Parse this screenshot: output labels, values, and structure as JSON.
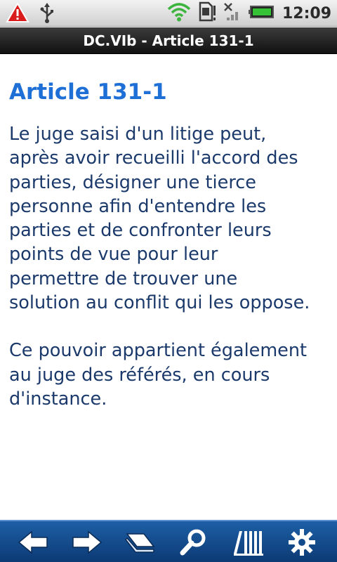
{
  "status_bar": {
    "time": "12:09",
    "icons": [
      "warning-icon",
      "usb-icon",
      "wifi-icon",
      "sd-card-icon",
      "no-signal-icon",
      "battery-icon"
    ]
  },
  "title_bar": {
    "title": "DC.VIb - Article 131-1"
  },
  "article": {
    "heading": "Article 131-1",
    "paragraphs": [
      "Le juge saisi d'un litige peut,\naprès avoir recueilli l'accord des\nparties, désigner une tierce\npersonne afin d'entendre les\nparties et de confronter leurs\npoints de vue pour leur\npermettre de trouver une\nsolution au conflit qui les oppose.",
      "Ce pouvoir appartient également\nau juge des référés, en cours\nd'instance."
    ]
  },
  "toolbar": {
    "buttons": [
      "back-arrow-icon",
      "forward-arrow-icon",
      "book-icon",
      "search-icon",
      "library-icon",
      "settings-gear-icon"
    ]
  },
  "colors": {
    "heading": "#1e6fd6",
    "body_text": "#1b3a6b",
    "toolbar": "#1d5fa6"
  }
}
